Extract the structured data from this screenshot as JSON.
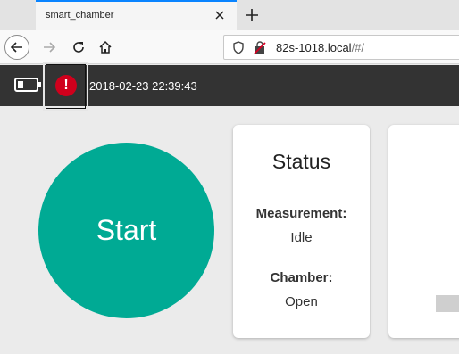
{
  "browser": {
    "tab_title": "smart_chamber",
    "url_host": "82s-1018.local",
    "url_path": "/#/"
  },
  "header": {
    "datetime": "2018-02-23 22:39:43"
  },
  "main": {
    "start_label": "Start",
    "status": {
      "title": "Status",
      "measurement_label": "Measurement:",
      "measurement_value": "Idle",
      "chamber_label": "Chamber:",
      "chamber_value": "Open"
    }
  },
  "colors": {
    "accent": "#00aa94",
    "header": "#333333",
    "alert": "#d0001c"
  },
  "icons": [
    "back-arrow-icon",
    "forward-arrow-icon",
    "reload-icon",
    "home-icon",
    "shield-icon",
    "insecure-lock-icon",
    "battery-icon",
    "alert-icon",
    "close-icon",
    "plus-icon"
  ]
}
